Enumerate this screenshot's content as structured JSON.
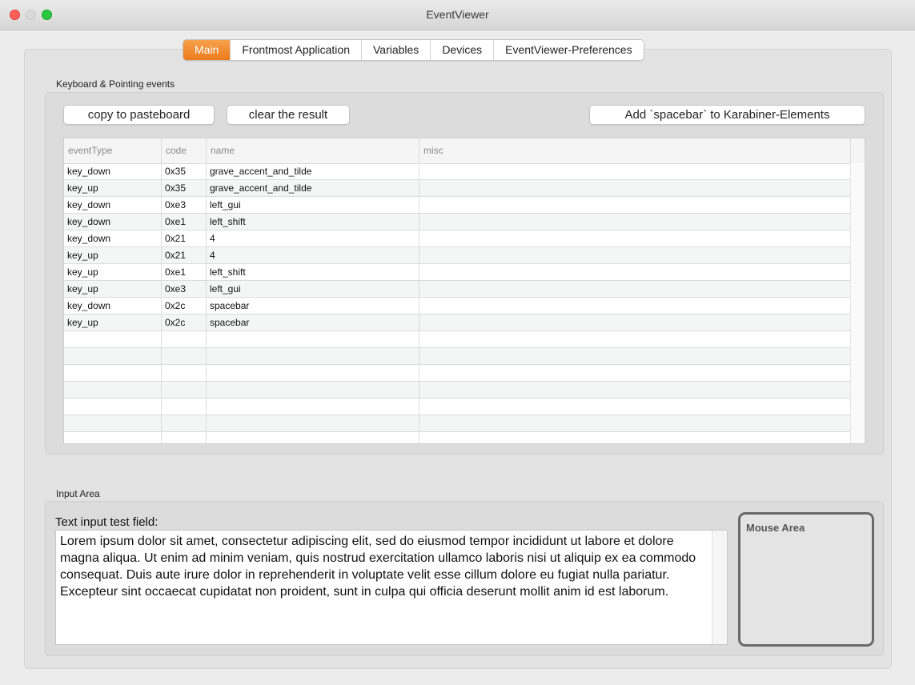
{
  "window": {
    "title": "EventViewer"
  },
  "tabs": [
    {
      "label": "Main",
      "active": true
    },
    {
      "label": "Frontmost Application",
      "active": false
    },
    {
      "label": "Variables",
      "active": false
    },
    {
      "label": "Devices",
      "active": false
    },
    {
      "label": "EventViewer-Preferences",
      "active": false
    }
  ],
  "keyboard": {
    "group_label": "Keyboard & Pointing events",
    "copy_button": "copy to pasteboard",
    "clear_button": "clear the result",
    "add_button": "Add `spacebar` to Karabiner-Elements",
    "columns": [
      "eventType",
      "code",
      "name",
      "misc"
    ],
    "rows": [
      [
        "key_down",
        "0x35",
        "grave_accent_and_tilde",
        ""
      ],
      [
        "key_up",
        "0x35",
        "grave_accent_and_tilde",
        ""
      ],
      [
        "key_down",
        "0xe3",
        "left_gui",
        ""
      ],
      [
        "key_down",
        "0xe1",
        "left_shift",
        ""
      ],
      [
        "key_down",
        "0x21",
        "4",
        ""
      ],
      [
        "key_up",
        "0x21",
        "4",
        ""
      ],
      [
        "key_up",
        "0xe1",
        "left_shift",
        ""
      ],
      [
        "key_up",
        "0xe3",
        "left_gui",
        ""
      ],
      [
        "key_down",
        "0x2c",
        "spacebar",
        ""
      ],
      [
        "key_up",
        "0x2c",
        "spacebar",
        ""
      ]
    ]
  },
  "input_area": {
    "group_label": "Input Area",
    "field_label": "Text input test field:",
    "text": "Lorem ipsum dolor sit amet, consectetur adipiscing elit, sed do eiusmod tempor incididunt ut labore et dolore magna aliqua. Ut enim ad minim veniam, quis nostrud exercitation ullamco laboris nisi ut aliquip ex ea commodo consequat. Duis aute irure dolor in reprehenderit in voluptate velit esse cillum dolore eu fugiat nulla pariatur. Excepteur sint occaecat cupidatat non proident, sunt in culpa qui officia deserunt mollit anim id est laborum.",
    "mouse_area_label": "Mouse Area"
  },
  "colors": {
    "accent": "#ef8424"
  }
}
